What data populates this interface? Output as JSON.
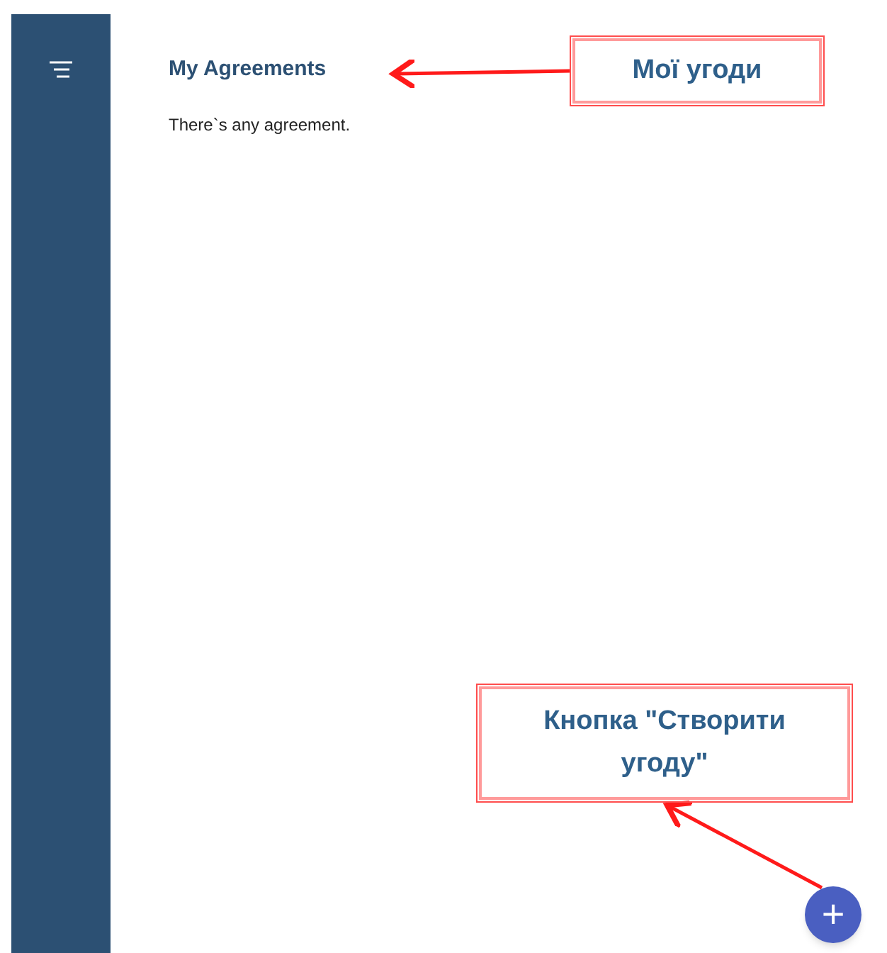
{
  "page": {
    "title": "My Agreements",
    "empty_message": "There`s any agreement."
  },
  "fab": {
    "label": "+"
  },
  "annotations": [
    {
      "text": "Мої угоди"
    },
    {
      "text": "Кнопка \"Створити угоду\""
    }
  ]
}
